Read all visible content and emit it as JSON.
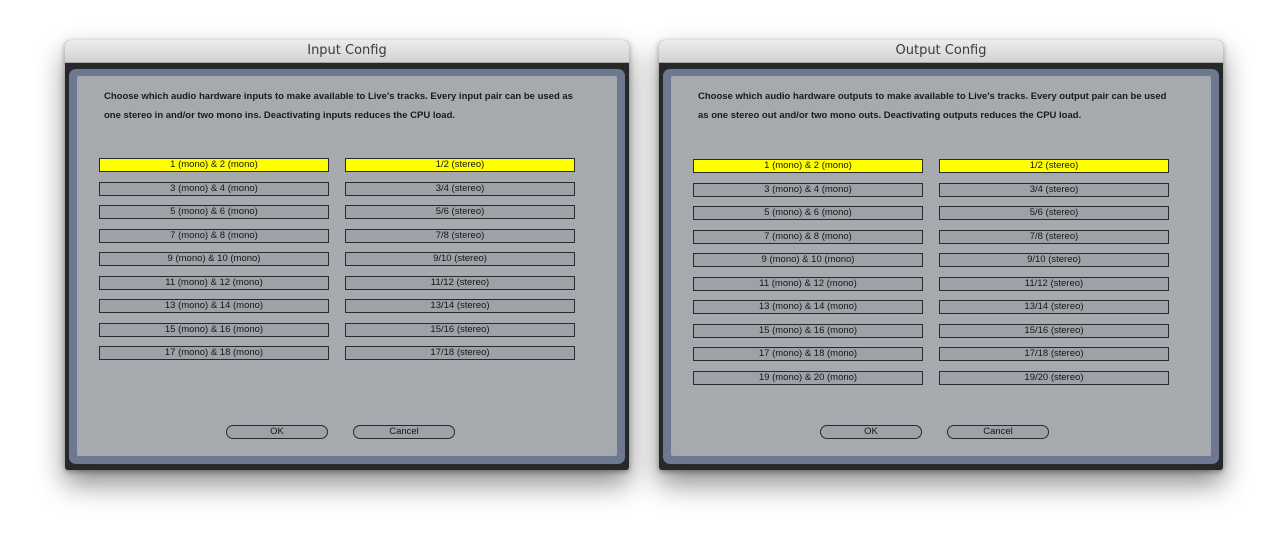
{
  "input_window": {
    "title": "Input Config",
    "description": "Choose which audio hardware inputs to make available to Live's tracks. Every input pair can be used as one stereo in and/or two mono ins.  Deactivating inputs reduces the CPU load.",
    "mono_pairs": [
      {
        "label": "1 (mono) & 2 (mono)",
        "active": true
      },
      {
        "label": "3 (mono) & 4 (mono)",
        "active": false
      },
      {
        "label": "5 (mono) & 6 (mono)",
        "active": false
      },
      {
        "label": "7 (mono) & 8 (mono)",
        "active": false
      },
      {
        "label": "9 (mono) & 10 (mono)",
        "active": false
      },
      {
        "label": "11 (mono) & 12 (mono)",
        "active": false
      },
      {
        "label": "13 (mono) & 14 (mono)",
        "active": false
      },
      {
        "label": "15 (mono) & 16 (mono)",
        "active": false
      },
      {
        "label": "17 (mono) & 18 (mono)",
        "active": false
      }
    ],
    "stereo_pairs": [
      {
        "label": "1/2 (stereo)",
        "active": true
      },
      {
        "label": "3/4 (stereo)",
        "active": false
      },
      {
        "label": "5/6 (stereo)",
        "active": false
      },
      {
        "label": "7/8 (stereo)",
        "active": false
      },
      {
        "label": "9/10 (stereo)",
        "active": false
      },
      {
        "label": "11/12 (stereo)",
        "active": false
      },
      {
        "label": "13/14 (stereo)",
        "active": false
      },
      {
        "label": "15/16 (stereo)",
        "active": false
      },
      {
        "label": "17/18 (stereo)",
        "active": false
      }
    ],
    "ok_label": "OK",
    "cancel_label": "Cancel"
  },
  "output_window": {
    "title": "Output Config",
    "description": "Choose which audio hardware outputs to make available to Live's tracks. Every output pair can be used as one stereo out and/or two mono outs.  Deactivating outputs reduces the CPU load.",
    "mono_pairs": [
      {
        "label": "1 (mono) & 2 (mono)",
        "active": true
      },
      {
        "label": "3 (mono) & 4 (mono)",
        "active": false
      },
      {
        "label": "5 (mono) & 6 (mono)",
        "active": false
      },
      {
        "label": "7 (mono) & 8 (mono)",
        "active": false
      },
      {
        "label": "9 (mono) & 10 (mono)",
        "active": false
      },
      {
        "label": "11 (mono) & 12 (mono)",
        "active": false
      },
      {
        "label": "13 (mono) & 14 (mono)",
        "active": false
      },
      {
        "label": "15 (mono) & 16 (mono)",
        "active": false
      },
      {
        "label": "17 (mono) & 18 (mono)",
        "active": false
      },
      {
        "label": "19 (mono) & 20 (mono)",
        "active": false
      }
    ],
    "stereo_pairs": [
      {
        "label": "1/2 (stereo)",
        "active": true
      },
      {
        "label": "3/4 (stereo)",
        "active": false
      },
      {
        "label": "5/6 (stereo)",
        "active": false
      },
      {
        "label": "7/8 (stereo)",
        "active": false
      },
      {
        "label": "9/10 (stereo)",
        "active": false
      },
      {
        "label": "11/12 (stereo)",
        "active": false
      },
      {
        "label": "13/14 (stereo)",
        "active": false
      },
      {
        "label": "15/16 (stereo)",
        "active": false
      },
      {
        "label": "17/18 (stereo)",
        "active": false
      },
      {
        "label": "19/20 (stereo)",
        "active": false
      }
    ],
    "ok_label": "OK",
    "cancel_label": "Cancel"
  },
  "colors": {
    "active_toggle": "#ffff00",
    "inactive_toggle": "#9ea2a8",
    "panel_background": "#a6a9ae",
    "panel_frame": "#6e7891"
  }
}
